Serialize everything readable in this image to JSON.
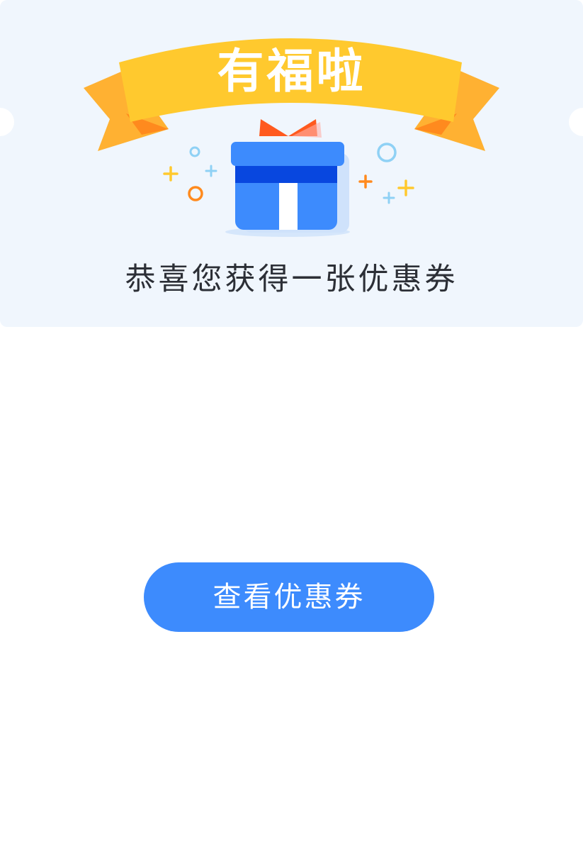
{
  "banner": {
    "title": "有福啦",
    "ribbon_color": "#ffc92e",
    "ribbon_tail_color": "#ffb132"
  },
  "gift": {
    "icon": "gift-box-icon",
    "box_color": "#3d8bfd",
    "band_color": "#0847df",
    "bow_color": "#ff5a1f"
  },
  "message": {
    "congrats": "恭喜您获得一张优惠券"
  },
  "actions": {
    "view_coupon_label": "查看优惠券",
    "button_color": "#3d8bfd"
  }
}
